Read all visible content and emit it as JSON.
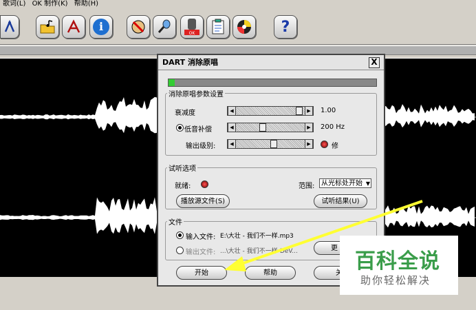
{
  "menubar": {
    "items": [
      "歌词(L)",
      "OK 制作(K)",
      "帮助(H)"
    ]
  },
  "toolbar": {
    "icons": [
      "compass-icon",
      "music-folder-icon",
      "text-a-icon",
      "info-icon",
      "mute-icon",
      "mic-icon",
      "ok-icon",
      "notepad-icon",
      "cd-icon",
      "help-icon"
    ],
    "help_glyph": "?",
    "info_glyph": "i"
  },
  "dialog": {
    "title": "DART 消除原唱",
    "close": "X",
    "progress_fraction": 0.03,
    "params": {
      "legend": "消除原唱参数设置",
      "attenuation_label": "衰减度",
      "attenuation_value": "1.00",
      "attenuation_fraction": 0.95,
      "bass_label": "低音补偿",
      "bass_value": "200 Hz",
      "bass_fraction": 0.38,
      "output_label": "输出级别:",
      "output_value": "修",
      "output_fraction": 0.55
    },
    "listen": {
      "legend": "试听选项",
      "ready_label": "就绪:",
      "range_label": "范围:",
      "range_value": "从光标处开始",
      "play_source": "播放源文件(S)",
      "listen_result": "试听结果(U)"
    },
    "files": {
      "legend": "文件",
      "input_label": "输入文件:",
      "input_value": "E:\\大壮 - 我们不一样.mp3",
      "output_label": "输出文件:",
      "output_value": "...\\大壮 - 我们不一样-DeV...",
      "change_btn": "更"
    },
    "buttons": {
      "start": "开始",
      "help": "帮助",
      "close": "关"
    }
  },
  "watermark": {
    "title": "百科全说",
    "subtitle": "助你轻松解决"
  },
  "colors": {
    "progress": "#33cc33",
    "arrow": "#ffff33",
    "watermark_green": "#3a9d4a"
  }
}
